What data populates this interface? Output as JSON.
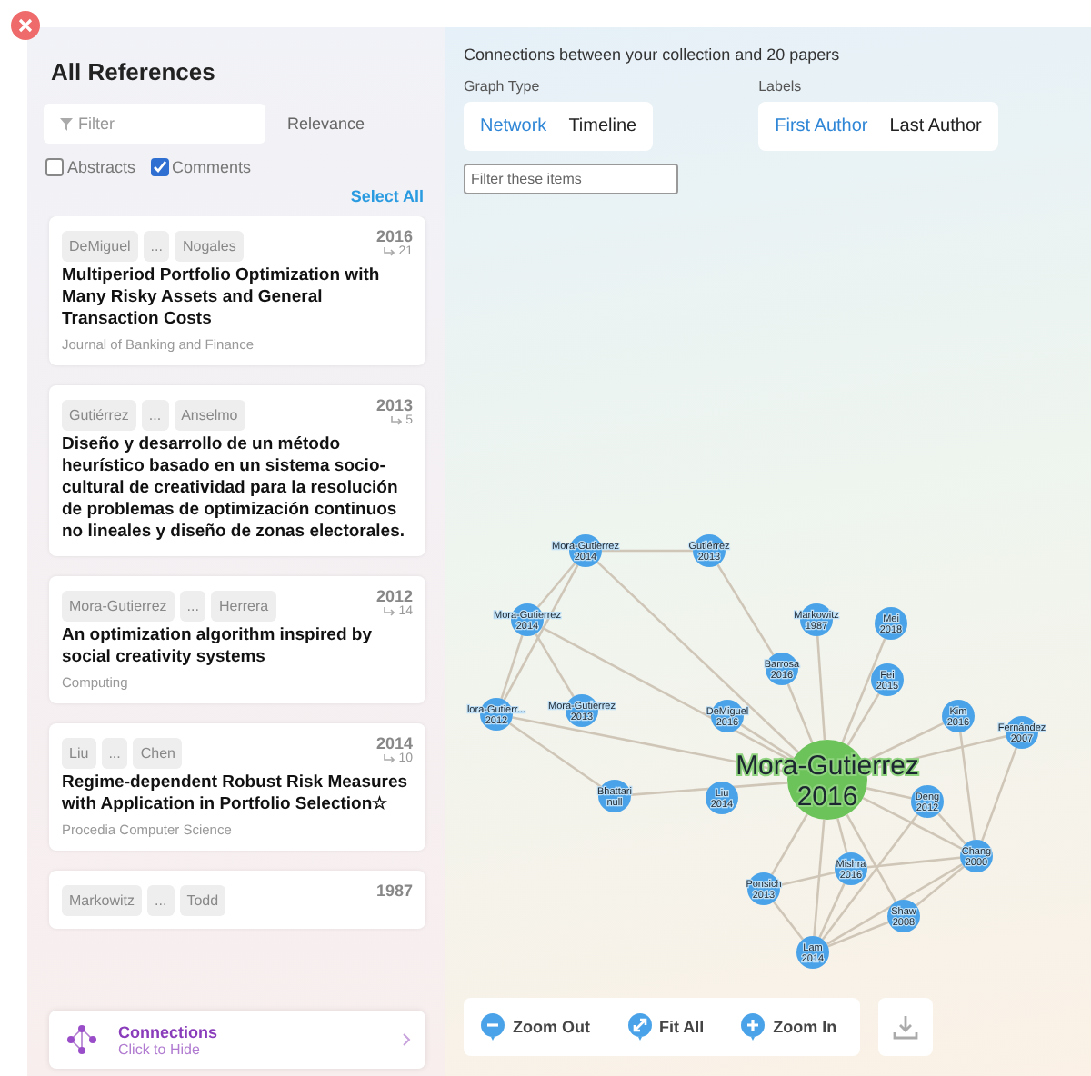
{
  "sidebar": {
    "title": "All References",
    "filter": {
      "placeholder": "Filter"
    },
    "sort": "Relevance",
    "options": [
      {
        "label": "Abstracts",
        "checked": false
      },
      {
        "label": "Comments",
        "checked": true
      }
    ],
    "select_all": "Select All",
    "references": [
      {
        "authors": [
          "DeMiguel",
          "...",
          "Nogales"
        ],
        "year": "2016",
        "citations": "21",
        "title": "Multiperiod Portfolio Optimization with Many Risky Assets and General Transaction Costs",
        "journal": "Journal of Banking and Finance"
      },
      {
        "authors": [
          "Gutiérrez",
          "...",
          "Anselmo"
        ],
        "year": "2013",
        "citations": "5",
        "title": "Diseño y desarrollo de un método heurístico basado en un sistema socio-cultural de creatividad para la resolución de problemas de optimización continuos no lineales y diseño de zonas electorales."
      },
      {
        "authors": [
          "Mora-Gutierrez",
          "...",
          "Herrera"
        ],
        "year": "2012",
        "citations": "14",
        "title": "An optimization algorithm inspired by social creativity systems",
        "journal": "Computing"
      },
      {
        "authors": [
          "Liu",
          "...",
          "Chen"
        ],
        "year": "2014",
        "citations": "10",
        "title": "Regime-dependent Robust Risk Measures with Application in Portfolio Selection☆",
        "journal": "Procedia Computer Science"
      },
      {
        "authors": [
          "Markowitz",
          "...",
          "Todd"
        ],
        "year": "1987"
      }
    ],
    "connections": {
      "title": "Connections",
      "subtitle": "Click to Hide"
    }
  },
  "main": {
    "heading": "Connections between your collection and 20 papers",
    "graph_type": {
      "label": "Graph Type",
      "options": [
        {
          "label": "Network",
          "selected": true
        },
        {
          "label": "Timeline",
          "selected": false
        }
      ]
    },
    "labels": {
      "label": "Labels",
      "options": [
        {
          "label": "First Author",
          "selected": true
        },
        {
          "label": "Last Author",
          "selected": false
        }
      ]
    },
    "filter": {
      "placeholder": "Filter these items"
    },
    "nodes": [
      {
        "name": "Mora-Gutierrez",
        "year": "2014"
      },
      {
        "name": "Gutiérrez",
        "year": "2013"
      },
      {
        "name": "Mora-Gutierrez",
        "year": "2014"
      },
      {
        "name": "Markowitz",
        "year": "1987"
      },
      {
        "name": "Mei",
        "year": "2018"
      },
      {
        "name": "Barrosa",
        "year": "2016"
      },
      {
        "name": "Fei",
        "year": "2015"
      },
      {
        "name": "lora-Gutierr...",
        "year": "2012"
      },
      {
        "name": "Mora-Gutierrez",
        "year": "2013"
      },
      {
        "name": "DeMiguel",
        "year": "2016"
      },
      {
        "name": "Kim",
        "year": "2016"
      },
      {
        "name": "Fernández",
        "year": "2007"
      },
      {
        "name": "Bhattari",
        "year": "null"
      },
      {
        "name": "Liu",
        "year": "2014"
      },
      {
        "name": "Mora-Gutierrez",
        "year": "2016",
        "kind": "focus"
      },
      {
        "name": "Deng",
        "year": "2012"
      },
      {
        "name": "Ponsich",
        "year": "2013"
      },
      {
        "name": "Mishra",
        "year": "2016"
      },
      {
        "name": "Chang",
        "year": "2000"
      },
      {
        "name": "Shaw",
        "year": "2008"
      },
      {
        "name": "Lam",
        "year": "2014"
      }
    ],
    "toolbar": [
      {
        "kind": "zoom-out",
        "label": "Zoom Out"
      },
      {
        "kind": "fit",
        "label": "Fit All"
      },
      {
        "kind": "zoom-in",
        "label": "Zoom In"
      }
    ]
  }
}
